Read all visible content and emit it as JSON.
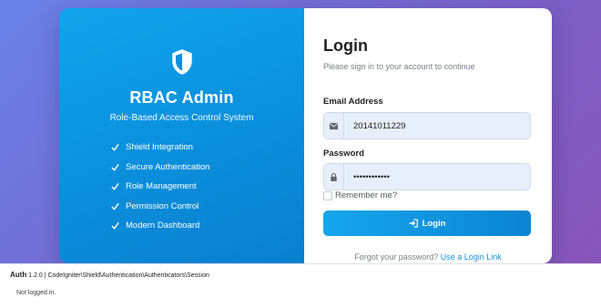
{
  "brand": {
    "title": "RBAC Admin",
    "subtitle": "Role-Based Access Control System",
    "icon": "shield-icon",
    "features": [
      "Shield Integration",
      "Secure Authentication",
      "Role Management",
      "Permission Control",
      "Modern Dashboard"
    ]
  },
  "login": {
    "heading": "Login",
    "subheading": "Please sign in to your account to continue",
    "email_label": "Email Address",
    "email_value": "20141011229",
    "password_label": "Password",
    "password_value": "••••••••••••",
    "remember_label": "Remember me?",
    "submit_label": "Login",
    "forgot_text": "Forgot your password?",
    "magic_link": "Use a Login Link"
  },
  "debug": {
    "name": "Auth",
    "details": "1.2.0 | CodeIgniter\\Shield\\Authentication\\Authenticators\\Session",
    "status": "Not logged in."
  },
  "colors": {
    "accent": "#0b8fdc",
    "background": "#7a5fc6"
  }
}
